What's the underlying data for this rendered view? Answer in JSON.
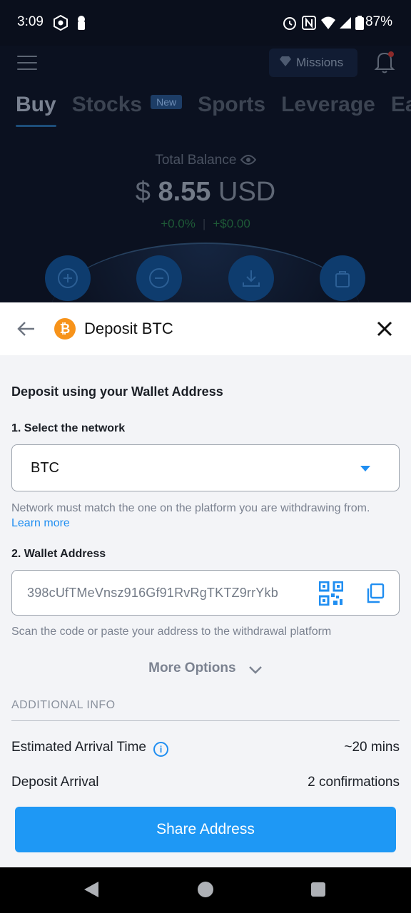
{
  "status_bar": {
    "time": "3:09",
    "battery": "87%"
  },
  "background_app": {
    "missions_label": "Missions",
    "tabs": [
      {
        "label": "Buy",
        "active": true
      },
      {
        "label": "Stocks",
        "badge": "New"
      },
      {
        "label": "Sports"
      },
      {
        "label": "Leverage"
      },
      {
        "label": "Ea"
      }
    ],
    "balance_label": "Total Balance",
    "balance_currency_symbol": "$",
    "balance_amount": "8.55",
    "balance_unit": "USD",
    "change_percent": "+0.0%",
    "change_amount": "+$0.00"
  },
  "sheet": {
    "title": "Deposit BTC",
    "coin_symbol": "₿",
    "section_title": "Deposit using your Wallet Address",
    "step1_label": "1. Select the network",
    "network_value": "BTC",
    "network_hint": "Network must match the one on the platform you are withdrawing from.",
    "learn_more": "Learn more",
    "step2_label": "2. Wallet Address",
    "wallet_address": "398cUfTMeVnsz916Gf91RvRgTKTZ9rrYkb",
    "address_hint": "Scan the code or paste your address to the withdrawal platform",
    "more_options": "More Options",
    "additional_info": "ADDITIONAL INFO",
    "rows": [
      {
        "label": "Estimated Arrival Time",
        "value": "~20 mins"
      },
      {
        "label": "Deposit Arrival",
        "value": "2 confirmations"
      }
    ],
    "share_button": "Share Address"
  },
  "colors": {
    "accent": "#1e98f5",
    "bitcoin": "#f7931a",
    "background_dark": "#0b1120",
    "sheet_bg": "#f3f4f7"
  }
}
